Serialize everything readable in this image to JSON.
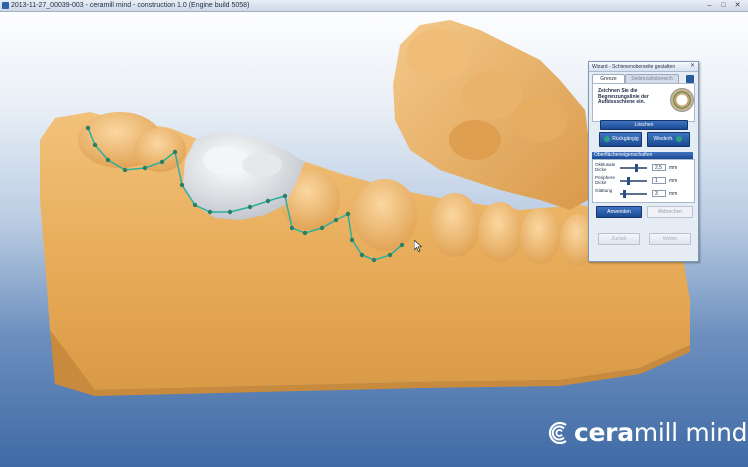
{
  "window": {
    "title": "2013-11-27_00039-003 - ceramill mind - construction 1.0 (Engine build 5058)",
    "min_icon": "minimize-icon",
    "max_icon": "maximize-icon",
    "close_icon": "close-icon",
    "min_glyph": "–",
    "max_glyph": "□",
    "close_glyph": "✕"
  },
  "wizard": {
    "title": "Wizard - Schienenoberseite gestalten",
    "close_glyph": "✕",
    "tabs": [
      {
        "label": "Grenze",
        "active": true
      },
      {
        "label": "Seitenzahnbereich",
        "active": false
      }
    ],
    "instruction": "Zeichnen Sie die Begrenzungslinie der Aufbissschiene ein.",
    "delete_label": "Löschen",
    "undo_label": "Rückgängig",
    "redo_label": "Wiederh.",
    "section_title": "Oberflächeneigenschaften",
    "properties": [
      {
        "label": "Okklusale Dicke",
        "value": "2,5",
        "unit": "mm",
        "slider": 0.6
      },
      {
        "label": "Periphere Dicke",
        "value": "1",
        "unit": "mm",
        "slider": 0.3
      },
      {
        "label": "Glättung",
        "value": "3",
        "unit": "mm",
        "slider": 0.15
      }
    ],
    "apply_label": "Anwenden",
    "cancel_label": "Abbrechen",
    "back_label": "Zurück",
    "next_label": "Weiter"
  },
  "logo": {
    "brand_bold": "cera",
    "brand_light": "mill mind"
  },
  "colors": {
    "model": "#e9b25f",
    "crown": "#e8ebee",
    "margin_line": "#2bb0a0",
    "accent": "#1b4a92"
  }
}
